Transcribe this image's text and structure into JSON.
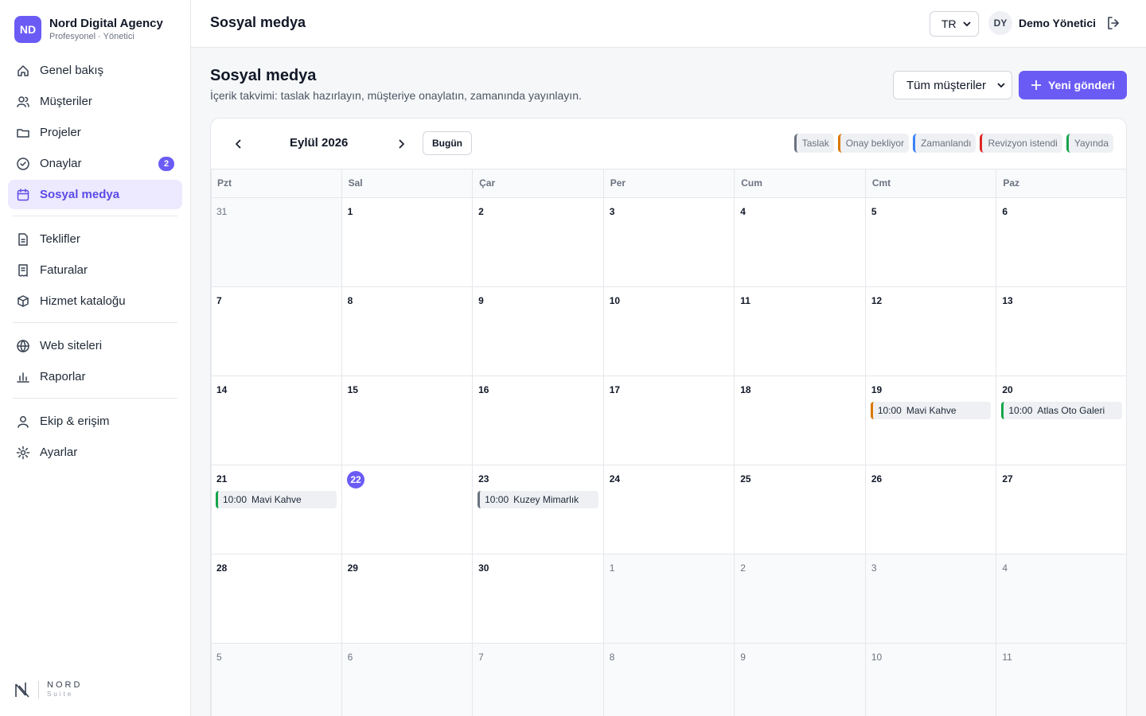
{
  "brand": {
    "initials": "ND",
    "name": "Nord Digital Agency",
    "subtitle": "Profesyonel · Yönetici"
  },
  "nav": {
    "group1": [
      {
        "id": "overview",
        "label": "Genel bakış",
        "icon": "home-icon"
      },
      {
        "id": "clients",
        "label": "Müşteriler",
        "icon": "users-icon"
      },
      {
        "id": "projects",
        "label": "Projeler",
        "icon": "folder-icon"
      },
      {
        "id": "approvals",
        "label": "Onaylar",
        "icon": "check-circle-icon",
        "badge": "2"
      },
      {
        "id": "social",
        "label": "Sosyal medya",
        "icon": "calendar-icon",
        "active": true
      }
    ],
    "group2": [
      {
        "id": "quotes",
        "label": "Teklifler",
        "icon": "document-icon"
      },
      {
        "id": "invoices",
        "label": "Faturalar",
        "icon": "receipt-icon"
      },
      {
        "id": "catalog",
        "label": "Hizmet kataloğu",
        "icon": "box-icon"
      }
    ],
    "group3": [
      {
        "id": "websites",
        "label": "Web siteleri",
        "icon": "globe-icon"
      },
      {
        "id": "reports",
        "label": "Raporlar",
        "icon": "bar-chart-icon"
      }
    ],
    "group4": [
      {
        "id": "team",
        "label": "Ekip & erişim",
        "icon": "user-icon"
      },
      {
        "id": "settings",
        "label": "Ayarlar",
        "icon": "gear-icon"
      }
    ]
  },
  "suite": {
    "name": "NORD",
    "sub": "Suite"
  },
  "topbar": {
    "title": "Sosyal medya",
    "lang": "TR",
    "user_initials": "DY",
    "user_name": "Demo Yönetici"
  },
  "page": {
    "title": "Sosyal medya",
    "subtitle": "İçerik takvimi: taslak hazırlayın, müşteriye onaylatın, zamanında yayınlayın.",
    "client_filter": "Tüm müşteriler",
    "new_post_label": "Yeni gönderi"
  },
  "calendar": {
    "month_label": "Eylül 2026",
    "today_label": "Bugün",
    "legend": [
      {
        "label": "Taslak",
        "color": "#6b7280"
      },
      {
        "label": "Onay bekliyor",
        "color": "#d97706"
      },
      {
        "label": "Zamanlandı",
        "color": "#3b82f6"
      },
      {
        "label": "Revizyon istendi",
        "color": "#dc2626"
      },
      {
        "label": "Yayında",
        "color": "#16a34a"
      }
    ],
    "weekdays": [
      "Pzt",
      "Sal",
      "Çar",
      "Per",
      "Cum",
      "Cmt",
      "Paz"
    ],
    "weeks": [
      [
        {
          "d": "31",
          "out": true
        },
        {
          "d": "1"
        },
        {
          "d": "2"
        },
        {
          "d": "3"
        },
        {
          "d": "4"
        },
        {
          "d": "5"
        },
        {
          "d": "6"
        }
      ],
      [
        {
          "d": "7"
        },
        {
          "d": "8"
        },
        {
          "d": "9"
        },
        {
          "d": "10"
        },
        {
          "d": "11"
        },
        {
          "d": "12"
        },
        {
          "d": "13"
        }
      ],
      [
        {
          "d": "14"
        },
        {
          "d": "15"
        },
        {
          "d": "16"
        },
        {
          "d": "17"
        },
        {
          "d": "18"
        },
        {
          "d": "19",
          "events": [
            {
              "time": "10:00",
              "title": "Mavi Kahve",
              "color": "#d97706"
            }
          ]
        },
        {
          "d": "20",
          "events": [
            {
              "time": "10:00",
              "title": "Atlas Oto Galeri",
              "color": "#16a34a"
            }
          ]
        }
      ],
      [
        {
          "d": "21",
          "events": [
            {
              "time": "10:00",
              "title": "Mavi Kahve",
              "color": "#16a34a"
            }
          ]
        },
        {
          "d": "22",
          "today": true
        },
        {
          "d": "23",
          "events": [
            {
              "time": "10:00",
              "title": "Kuzey Mimarlık",
              "color": "#6b7280"
            }
          ]
        },
        {
          "d": "24"
        },
        {
          "d": "25"
        },
        {
          "d": "26"
        },
        {
          "d": "27"
        }
      ],
      [
        {
          "d": "28"
        },
        {
          "d": "29"
        },
        {
          "d": "30"
        },
        {
          "d": "1",
          "out": true
        },
        {
          "d": "2",
          "out": true
        },
        {
          "d": "3",
          "out": true
        },
        {
          "d": "4",
          "out": true
        }
      ],
      [
        {
          "d": "5",
          "out": true
        },
        {
          "d": "6",
          "out": true
        },
        {
          "d": "7",
          "out": true
        },
        {
          "d": "8",
          "out": true
        },
        {
          "d": "9",
          "out": true
        },
        {
          "d": "10",
          "out": true
        },
        {
          "d": "11",
          "out": true
        }
      ]
    ]
  }
}
